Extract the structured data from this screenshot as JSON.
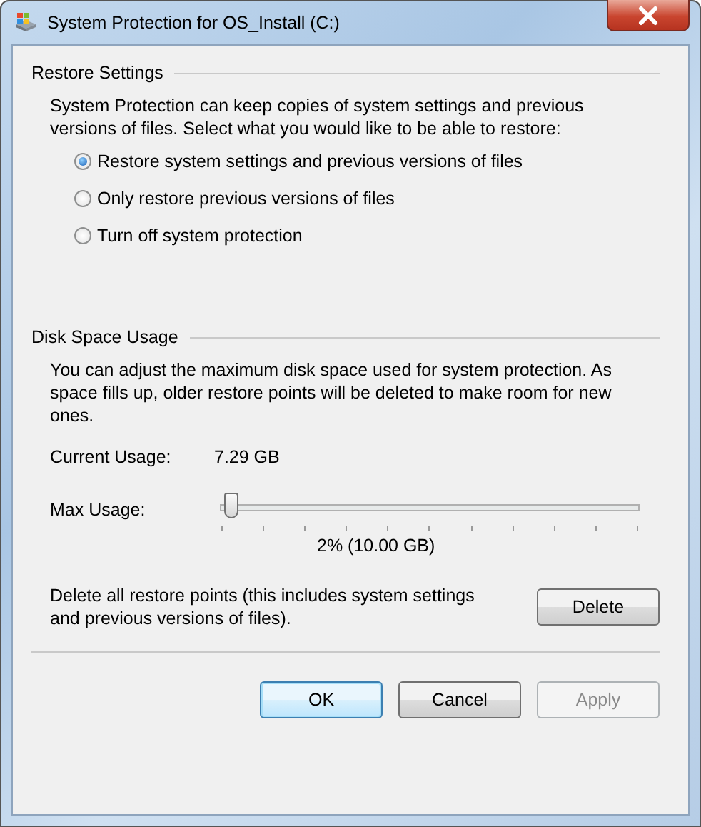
{
  "window": {
    "title": "System Protection for OS_Install (C:)"
  },
  "restore_settings": {
    "heading": "Restore Settings",
    "description": "System Protection can keep copies of system settings and previous versions of files. Select what you would like to be able to restore:",
    "options": [
      {
        "label": "Restore system settings and previous versions of files",
        "selected": true
      },
      {
        "label": "Only restore previous versions of files",
        "selected": false
      },
      {
        "label": "Turn off system protection",
        "selected": false
      }
    ]
  },
  "disk_space_usage": {
    "heading": "Disk Space Usage",
    "description": "You can adjust the maximum disk space used for system protection. As space fills up, older restore points will be deleted to make room for new ones.",
    "current_usage": {
      "label": "Current Usage:",
      "value": "7.29 GB"
    },
    "max_usage": {
      "label": "Max Usage:",
      "level": 0.02,
      "reading": "2% (10.00 GB)"
    },
    "delete": {
      "description": "Delete all restore points (this includes system settings and previous versions of files).",
      "button": "Delete"
    }
  },
  "buttons": [
    {
      "label": "OK",
      "default": true,
      "disabled": false
    },
    {
      "label": "Cancel",
      "default": false,
      "disabled": false
    },
    {
      "label": "Apply",
      "default": false,
      "disabled": true
    }
  ]
}
